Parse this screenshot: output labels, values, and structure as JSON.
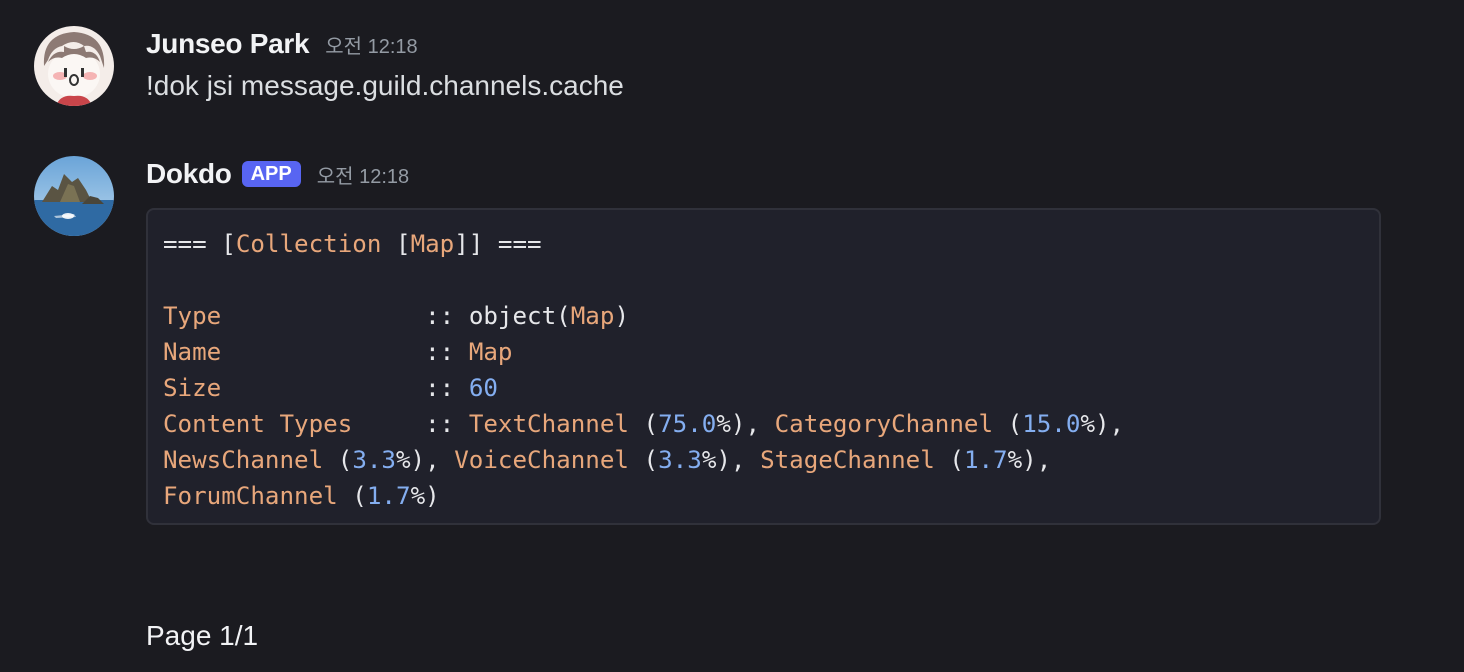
{
  "messages": [
    {
      "author": "Junseo Park",
      "timestamp": "오전 12:18",
      "content": "!dok jsi message.guild.channels.cache"
    },
    {
      "author": "Dokdo",
      "badge": "APP",
      "timestamp": "오전 12:18",
      "code": {
        "title": {
          "pre": "=== [",
          "collection": "Collection",
          "mid": " [",
          "map": "Map",
          "post": "]] ==="
        },
        "type_row": {
          "key": "Type",
          "sep": ":: ",
          "val_pre": "object(",
          "val_class": "Map",
          "val_post": ")"
        },
        "name_row": {
          "key": "Name",
          "sep": ":: ",
          "val": "Map"
        },
        "size_row": {
          "key": "Size",
          "sep": ":: ",
          "val": "60"
        },
        "content_types_key": "Content Types",
        "content_types_sep": ":: ",
        "content_types": [
          {
            "name": "TextChannel",
            "pct": "75.0"
          },
          {
            "name": "CategoryChannel",
            "pct": "15.0"
          },
          {
            "name": "NewsChannel",
            "pct": "3.3"
          },
          {
            "name": "VoiceChannel",
            "pct": "3.3"
          },
          {
            "name": "StageChannel",
            "pct": "1.7"
          },
          {
            "name": "ForumChannel",
            "pct": "1.7"
          }
        ]
      }
    }
  ],
  "pagination": {
    "label": "Page 1/1"
  },
  "colors": {
    "background": "#1b1b20",
    "code_bg": "#20212b",
    "keyword": "#e8a77b",
    "number": "#84aef0",
    "badge": "#5865f2"
  }
}
